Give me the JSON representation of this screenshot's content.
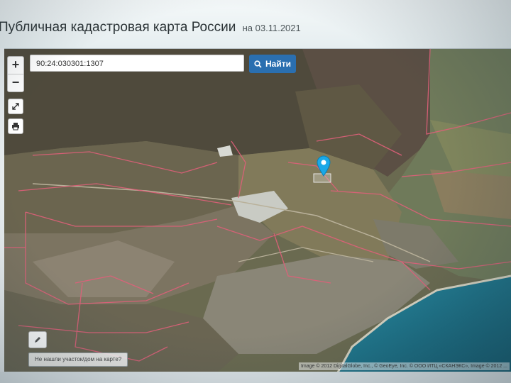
{
  "header": {
    "title": "Публичная кадастровая карта России",
    "date": "на 03.11.2021"
  },
  "map": {
    "zoom_in_label": "+",
    "zoom_out_label": "−",
    "search": {
      "value": "90:24:030301:1307",
      "button_label": "Найти"
    },
    "not_found_link": "Не нашли участок/дом на карте?",
    "attribution": "Image © 2012 DigitalGlobe, Inc., © GeoEye, Inc. © ООО ИТЦ «СКАНЭКС», Image © 2012 ..."
  },
  "colors": {
    "accent": "#2a6fb0",
    "pin": "#1aa8e8",
    "parcel_border": "#e0607a",
    "sea": "#1c6e86"
  },
  "icons": [
    "expand-icon",
    "print-icon",
    "search-icon",
    "location-pin-icon",
    "pencil-icon"
  ]
}
